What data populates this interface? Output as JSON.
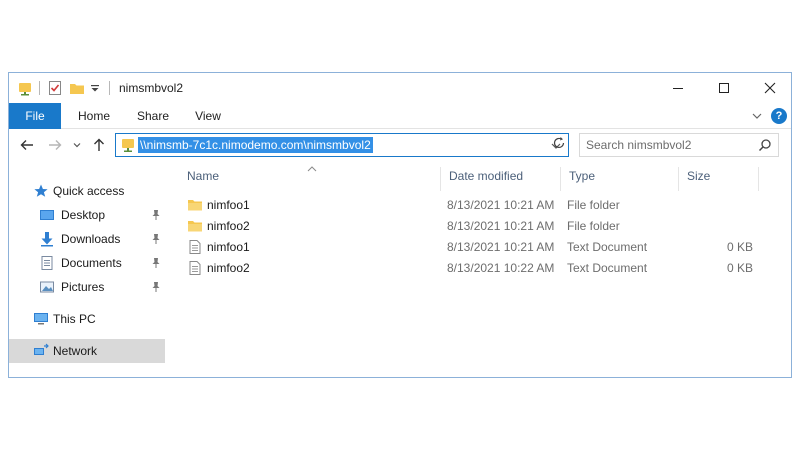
{
  "window": {
    "title": "nimsmbvol2",
    "quick_access_toolbar": [
      "folder-icon",
      "properties-icon",
      "new-folder-icon",
      "customize-dropdown-icon"
    ],
    "caption_buttons": [
      "minimize-icon",
      "maximize-icon",
      "close-icon"
    ]
  },
  "ribbon": {
    "tabs": [
      {
        "label": "File",
        "active": true
      },
      {
        "label": "Home"
      },
      {
        "label": "Share"
      },
      {
        "label": "View"
      }
    ],
    "help_label": "?"
  },
  "nav": {
    "address": "\\\\nimsmb-7c1c.nimodemo.com\\nimsmbvol2",
    "search_placeholder": "Search nimsmbvol2"
  },
  "sidebar": {
    "items": [
      {
        "label": "Quick access",
        "icon": "star-icon"
      },
      {
        "label": "Desktop",
        "icon": "desktop-icon",
        "pinned": true
      },
      {
        "label": "Downloads",
        "icon": "download-icon",
        "pinned": true
      },
      {
        "label": "Documents",
        "icon": "documents-icon",
        "pinned": true
      },
      {
        "label": "Pictures",
        "icon": "pictures-icon",
        "pinned": true
      },
      {
        "label": "This PC",
        "icon": "computer-icon"
      },
      {
        "label": "Network",
        "icon": "network-icon",
        "selected": true
      }
    ]
  },
  "files": {
    "columns": [
      "Name",
      "Date modified",
      "Type",
      "Size"
    ],
    "rows": [
      {
        "name": "nimfoo1",
        "date": "8/13/2021 10:21 AM",
        "type": "File folder",
        "size": "",
        "icon": "folder-icon"
      },
      {
        "name": "nimfoo2",
        "date": "8/13/2021 10:21 AM",
        "type": "File folder",
        "size": "",
        "icon": "folder-icon"
      },
      {
        "name": "nimfoo1",
        "date": "8/13/2021 10:21 AM",
        "type": "Text Document",
        "size": "0 KB",
        "icon": "text-document-icon"
      },
      {
        "name": "nimfoo2",
        "date": "8/13/2021 10:22 AM",
        "type": "Text Document",
        "size": "0 KB",
        "icon": "text-document-icon"
      }
    ]
  },
  "colors": {
    "accent": "#1979ca",
    "selection": "#3390e6",
    "folder": "#f5c750",
    "sidebar_selected": "#d9d9d9"
  }
}
